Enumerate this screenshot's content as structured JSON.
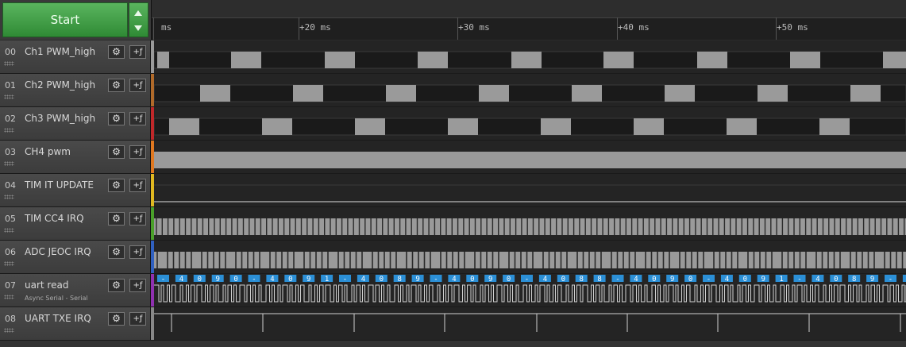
{
  "toolbar": {
    "start_label": "Start"
  },
  "ruler": {
    "unit_label": "ms",
    "ticks": [
      "+20 ms",
      "+30 ms",
      "+40 ms",
      "+50 ms"
    ]
  },
  "channels": [
    {
      "index": "00",
      "name": "Ch1  PWM_high",
      "color": "#9a9a9a"
    },
    {
      "index": "01",
      "name": "Ch2 PWM_high",
      "color": "#b06a2a"
    },
    {
      "index": "02",
      "name": "Ch3 PWM_high",
      "color": "#c0282a"
    },
    {
      "index": "03",
      "name": "CH4 pwm",
      "color": "#e07820"
    },
    {
      "index": "04",
      "name": "TIM IT UPDATE",
      "color": "#e0b820"
    },
    {
      "index": "05",
      "name": "TIM CC4 IRQ",
      "color": "#4aa02a"
    },
    {
      "index": "06",
      "name": "ADC JEOC IRQ",
      "color": "#3060c0"
    },
    {
      "index": "07",
      "name": "uart read",
      "sub": "Async Serial - Serial",
      "color": "#9030b0"
    },
    {
      "index": "08",
      "name": "UART TXE IRQ",
      "color": "#888888"
    }
  ],
  "uart_decoded": [
    "-",
    "4",
    "0",
    "9",
    "0",
    "-",
    "4",
    "0",
    "9",
    "1",
    "-",
    "4",
    "0",
    "8",
    "9",
    "-",
    "4",
    "0",
    "9",
    "0",
    "-",
    "4",
    "0",
    "8",
    "8",
    "-",
    "4",
    "0",
    "9",
    "0",
    "-",
    "4",
    "0",
    "9",
    "1",
    "-",
    "4",
    "0",
    "8",
    "9",
    "-",
    "4"
  ],
  "icons": {
    "settings": "gear-icon",
    "add_analyzer": "add-analyzer-icon"
  }
}
